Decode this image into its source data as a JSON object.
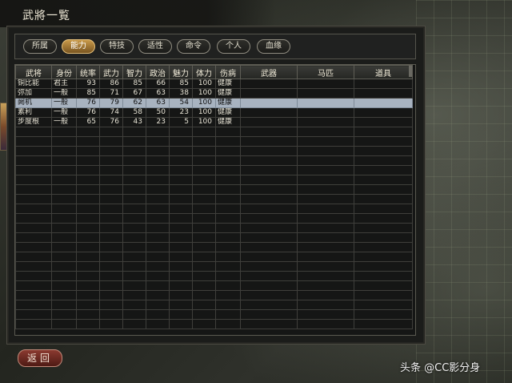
{
  "window": {
    "title": "武將一覧"
  },
  "tabs": [
    {
      "label": "所属",
      "active": false
    },
    {
      "label": "能力",
      "active": true
    },
    {
      "label": "特技",
      "active": false
    },
    {
      "label": "适性",
      "active": false
    },
    {
      "label": "命令",
      "active": false
    },
    {
      "label": "个人",
      "active": false
    },
    {
      "label": "血缘",
      "active": false
    }
  ],
  "table": {
    "columns": [
      "武将",
      "身份",
      "统率",
      "武力",
      "智力",
      "政治",
      "魅力",
      "体力",
      "伤病",
      "武器",
      "马匹",
      "道具"
    ],
    "rows": [
      {
        "cells": [
          "铜比能",
          "君主",
          "93",
          "86",
          "85",
          "66",
          "85",
          "100",
          "健康",
          "",
          "",
          ""
        ],
        "selected": false
      },
      {
        "cells": [
          "弥加",
          "一般",
          "85",
          "71",
          "67",
          "63",
          "38",
          "100",
          "健康",
          "",
          "",
          ""
        ],
        "selected": false
      },
      {
        "cells": [
          "阙机",
          "一般",
          "76",
          "79",
          "62",
          "63",
          "54",
          "100",
          "健康",
          "",
          "",
          ""
        ],
        "selected": true
      },
      {
        "cells": [
          "素利",
          "一般",
          "76",
          "74",
          "58",
          "50",
          "23",
          "100",
          "健康",
          "",
          "",
          ""
        ],
        "selected": false
      },
      {
        "cells": [
          "步度根",
          "一般",
          "65",
          "76",
          "43",
          "23",
          "5",
          "100",
          "健康",
          "",
          "",
          ""
        ],
        "selected": false
      }
    ]
  },
  "back_button": {
    "label": "返回"
  },
  "watermark": {
    "text": "头条 @CC影分身"
  },
  "colors": {
    "accent_tab": "#c99a4a",
    "selected_row": "#a8b3c0",
    "back_button": "#8a3a30"
  }
}
